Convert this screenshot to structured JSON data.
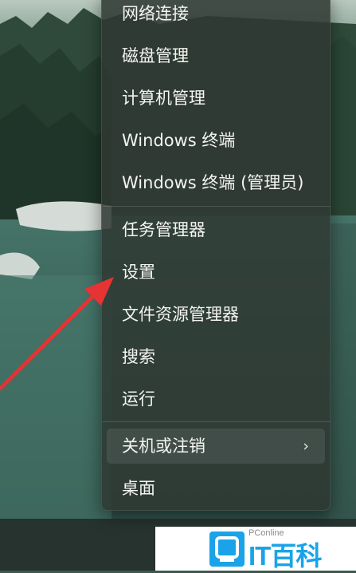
{
  "context_menu": {
    "items": [
      {
        "label": "网络连接"
      },
      {
        "label": "磁盘管理"
      },
      {
        "label": "计算机管理"
      },
      {
        "label": "Windows 终端"
      },
      {
        "label": "Windows 终端 (管理员)"
      },
      {
        "label": "任务管理器"
      },
      {
        "label": "设置"
      },
      {
        "label": "文件资源管理器"
      },
      {
        "label": "搜索"
      },
      {
        "label": "运行"
      },
      {
        "label": "关机或注销",
        "has_submenu": true,
        "submenu_icon": "chevron-right-icon"
      },
      {
        "label": "桌面"
      }
    ]
  },
  "annotation": {
    "arrow_color": "#e63333",
    "points_to": "设置"
  },
  "watermark": {
    "small_text": "PConline",
    "brand_text": "IT百科",
    "color": "#1aa3e8"
  }
}
